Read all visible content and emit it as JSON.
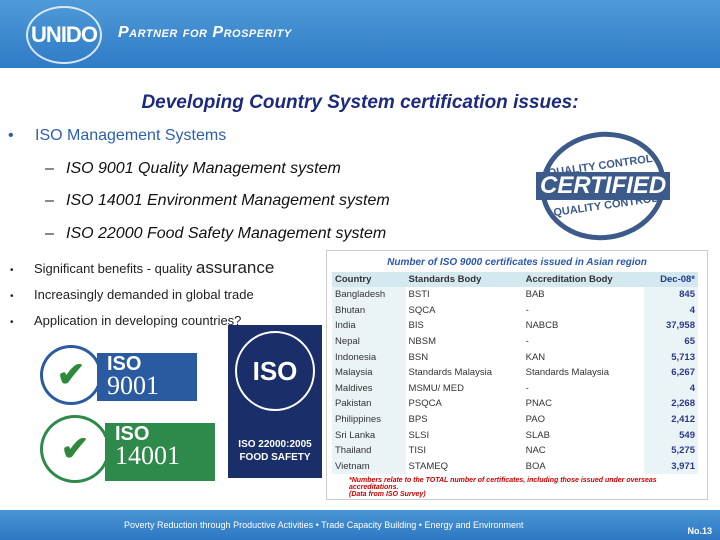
{
  "header": {
    "logo": "UNIDO",
    "tagline": "Partner for Prosperity"
  },
  "title": "Developing Country System certification issues:",
  "main_bullet": "ISO Management Systems",
  "sub_items": [
    "ISO 9001 Quality Management system",
    "ISO 14001 Environment Management system",
    "ISO 22000 Food Safety Management system"
  ],
  "bullets": [
    {
      "text": "Significant benefits - quality ",
      "emph": "assurance"
    },
    {
      "text": "Increasingly demanded in global trade"
    },
    {
      "text": "Application in developing countries?"
    }
  ],
  "stamp": {
    "top": "QUALITY CONTROL",
    "main": "CERTIFIED",
    "bottom": "QUALITY CONTROL"
  },
  "table": {
    "caption": "Number of ISO 9000 certificates issued in Asian region",
    "headers": [
      "Country",
      "Standards Body",
      "Accreditation Body",
      "Dec-08*"
    ],
    "rows": [
      [
        "Bangladesh",
        "BSTI",
        "BAB",
        "845"
      ],
      [
        "Bhutan",
        "SQCA",
        "-",
        "4"
      ],
      [
        "India",
        "BIS",
        "NABCB",
        "37,958"
      ],
      [
        "Nepal",
        "NBSM",
        "-",
        "65"
      ],
      [
        "Indonesia",
        "BSN",
        "KAN",
        "5,713"
      ],
      [
        "Malaysia",
        "Standards Malaysia",
        "Standards Malaysia",
        "6,267"
      ],
      [
        "Maldives",
        "MSMU/ MED",
        "-",
        "4"
      ],
      [
        "Pakistan",
        "PSQCA",
        "PNAC",
        "2,268"
      ],
      [
        "Philippines",
        "BPS",
        "PAO",
        "2,412"
      ],
      [
        "Sri Lanka",
        "SLSI",
        "SLAB",
        "549"
      ],
      [
        "Thailand",
        "TISI",
        "NAC",
        "5,275"
      ],
      [
        "Vietnam",
        "STAMEQ",
        "BOA",
        "3,971"
      ]
    ],
    "note": "*Numbers relate to the TOTAL number of certificates, including those issued under overseas accreditations.",
    "source": "(Data from ISO Survey)"
  },
  "logos": {
    "iso9001": {
      "name": "ISO",
      "num": "9001"
    },
    "iso14001": {
      "name": "ISO",
      "num": "14001"
    },
    "iso22000": {
      "name": "ISO",
      "line1": "ISO 22000:2005",
      "line2": "FOOD SAFETY"
    }
  },
  "footer": {
    "text": "Poverty Reduction through Productive Activities  •  Trade Capacity Building  •  Energy and Environment",
    "page": "No.13"
  }
}
